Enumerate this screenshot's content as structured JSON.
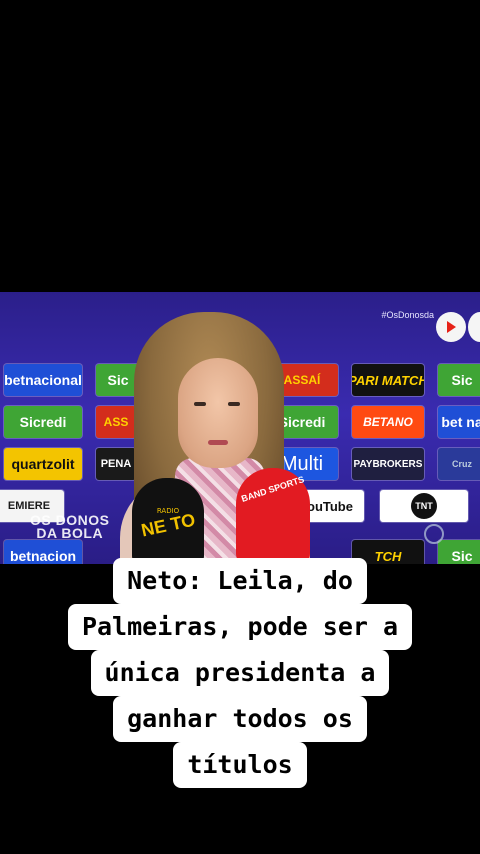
{
  "video": {
    "hashtag": "#OsDonosda",
    "watermark_line1": "OS DONOS",
    "watermark_line2": "DA BOLA",
    "sponsors": {
      "betnacional_a": "betnacional",
      "sicredi_a": "Sic",
      "assai": "ASSAÍ",
      "parimatch": "PARI MATCH",
      "sicredi_b": "Sic",
      "sicredi_c": "Sicredi",
      "assai_b": "ASS",
      "sicredi_d": "Sicredi",
      "betano": "BETANO",
      "betnacional_b": "bet na",
      "quartzolit": "quartzolit",
      "penalty": "PENA",
      "multi": "Multi",
      "paybrokers": "PAYBROKERS",
      "cruzeiro": "Cruz",
      "premiere": "EMIERE",
      "youtube": "ouTube",
      "tnt": "TNT",
      "betnacional_c": "betnacion",
      "parimatch_b": "TCH",
      "sicredi_e": "Sic"
    },
    "mic_neto": "NE TO",
    "mic_neto_sub": "RADIO",
    "mic_band": "BAND SPORTS"
  },
  "caption": {
    "lines": [
      "Neto: Leila, do",
      "Palmeiras, pode ser a",
      "única presidenta a",
      "ganhar todos os",
      "títulos"
    ]
  },
  "icons": {
    "youtube": "youtube-play-icon"
  }
}
